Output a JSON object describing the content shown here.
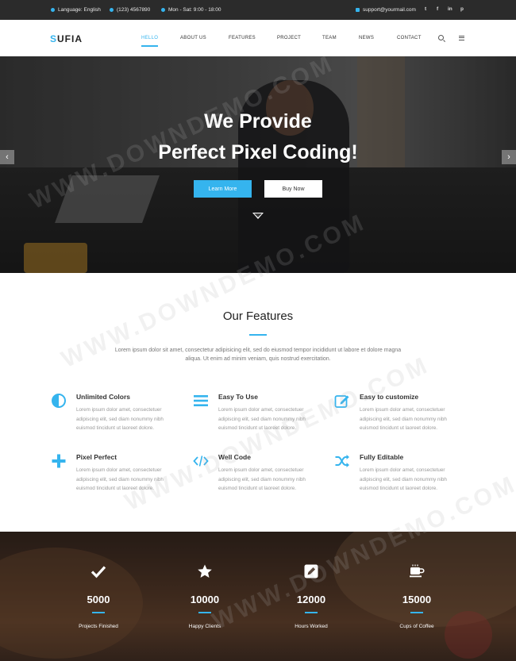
{
  "topbar": {
    "language": "Language: English",
    "phone": "(123) 4567890",
    "hours": "Mon - Sat: 9:00 - 18:00",
    "email": "support@yourmail.com",
    "social": [
      "t",
      "f",
      "in",
      "p"
    ]
  },
  "nav": {
    "logo_accent": "S",
    "logo_rest": "UFIA",
    "items": [
      {
        "label": "HELLO",
        "active": true
      },
      {
        "label": "ABOUT US"
      },
      {
        "label": "FEATURES"
      },
      {
        "label": "PROJECT"
      },
      {
        "label": "TEAM"
      },
      {
        "label": "NEWS"
      },
      {
        "label": "CONTACT"
      }
    ]
  },
  "hero": {
    "line1": "We Provide",
    "line2": "Perfect Pixel Coding!",
    "primary_button": "Learn More",
    "secondary_button": "Buy Now",
    "prev_arrow": "‹",
    "next_arrow": "›"
  },
  "features": {
    "title": "Our Features",
    "intro": "Lorem ipsum dolor sit amet, consectetur adipisicing elit, sed do eiusmod tempor incididunt ut labore et dolore magna aliqua. Ut enim ad minim veniam, quis nostrud exercitation.",
    "items": [
      {
        "title": "Unlimited Colors",
        "icon": "contrast-icon",
        "text": "Lorem ipsum dolor amet, consectetuer adipiscing elit, sed diam nonummy nibh euismod tincidunt ut laoreet dolore."
      },
      {
        "title": "Easy To Use",
        "icon": "menu-lines-icon",
        "text": "Lorem ipsum dolor amet, consectetuer adipiscing elit, sed diam nonummy nibh euismod tincidunt ut laoreet dolore."
      },
      {
        "title": "Easy to customize",
        "icon": "edit-icon",
        "text": "Lorem ipsum dolor amet, consectetuer adipiscing elit, sed diam nonummy nibh euismod tincidunt ut laoreet dolore."
      },
      {
        "title": "Pixel Perfect",
        "icon": "plus-icon",
        "text": "Lorem ipsum dolor amet, consectetuer adipiscing elit, sed diam nonummy nibh euismod tincidunt ut laoreet dolore."
      },
      {
        "title": "Well Code",
        "icon": "code-icon",
        "text": "Lorem ipsum dolor amet, consectetuer adipiscing elit, sed diam nonummy nibh euismod tincidunt ut laoreet dolore."
      },
      {
        "title": "Fully Editable",
        "icon": "shuffle-icon",
        "text": "Lorem ipsum dolor amet, consectetuer adipiscing elit, sed diam nonummy nibh euismod tincidunt ut laoreet dolore."
      }
    ]
  },
  "counters": [
    {
      "value": "5000",
      "label": "Projects Finished",
      "icon": "check-icon"
    },
    {
      "value": "10000",
      "label": "Happy Clients",
      "icon": "star-icon"
    },
    {
      "value": "12000",
      "label": "Hours Worked",
      "icon": "pencil-icon"
    },
    {
      "value": "15000",
      "label": "Cups of Coffee",
      "icon": "coffee-icon"
    }
  ],
  "watermark": "WWW.DOWNDEMO.COM",
  "colors": {
    "accent": "#35b4ee",
    "topbar": "#2b2b2b"
  }
}
